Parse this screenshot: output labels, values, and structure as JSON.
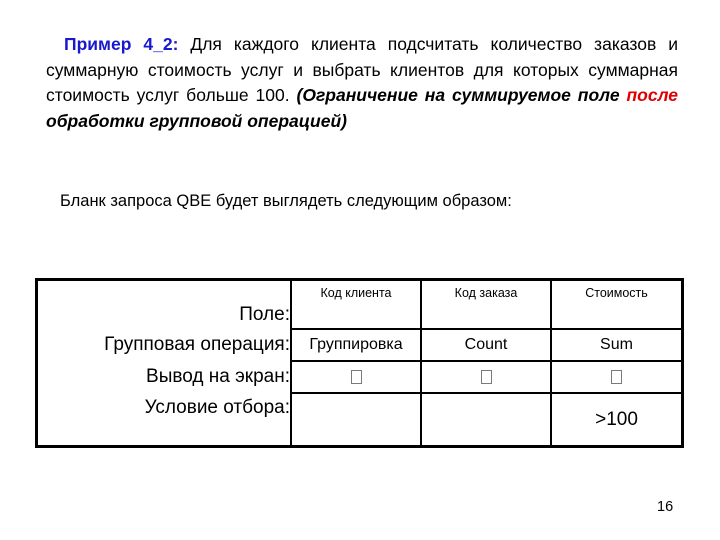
{
  "slide": {
    "example_label": "Пример 4_2",
    "example_colon": ":",
    "body_plain_1": " Для каждого клиента подсчитать количество заказов и суммарную стоимость услуг и выбрать клиентов для которых суммарная стоимость услуг больше 100. ",
    "body_bold_italic_1": "(Ограничение на суммируемое поле ",
    "body_bold_italic_red": "после",
    "body_bold_italic_2": " обработки групповой операцией)",
    "subtitle": "Бланк запроса QBE будет выглядеть следующим образом:",
    "page_number": "16"
  },
  "colors": {
    "example_blue": "#1818cf",
    "accent_red": "#e00000",
    "table_border": "#000000",
    "checkbox_gray": "#7a7a7a",
    "background": "#ffffff"
  },
  "qbe": {
    "row_labels": [
      "Поле:",
      "Групповая операция:",
      "Вывод на экран:",
      "Условие отбора:"
    ],
    "columns": [
      {
        "field": "Код клиента",
        "group_operation": "Группировка",
        "show_on_screen": "checkbox-empty",
        "criteria": ""
      },
      {
        "field": "Код заказа",
        "group_operation": "Count",
        "show_on_screen": "checkbox-empty",
        "criteria": ""
      },
      {
        "field": "Стоимость",
        "group_operation": "Sum",
        "show_on_screen": "checkbox-empty",
        "criteria": ">100"
      }
    ]
  }
}
